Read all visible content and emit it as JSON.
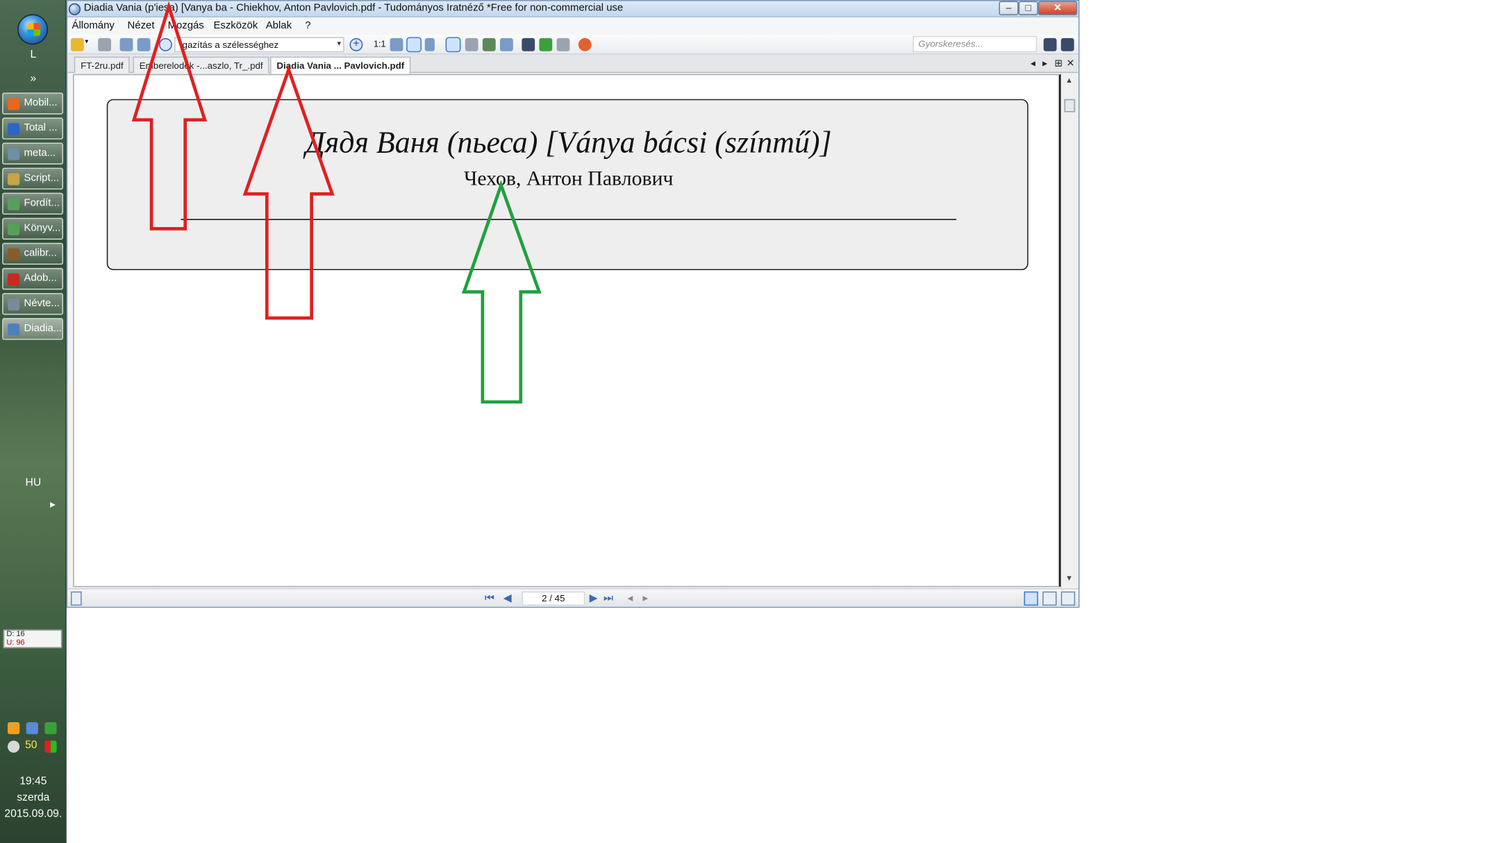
{
  "taskbar": {
    "letter": "L",
    "expand": "»",
    "buttons": [
      {
        "label": "Mobil...",
        "color": "#e8661e"
      },
      {
        "label": "Total ...",
        "color": "#2f65c8"
      },
      {
        "label": "meta...",
        "color": "#6f8fa8"
      },
      {
        "label": "Script...",
        "color": "#c9a347"
      },
      {
        "label": "Fordít...",
        "color": "#58a05a"
      },
      {
        "label": "Könyv...",
        "color": "#58a05a"
      },
      {
        "label": "calibr...",
        "color": "#8a5a2a"
      },
      {
        "label": "Adob...",
        "color": "#c92a1e"
      },
      {
        "label": "Névte...",
        "color": "#7a8a9a"
      },
      {
        "label": "Diadia...",
        "color": "#4f7fbf"
      }
    ],
    "net_down": "D: 16",
    "net_up": "U: 96",
    "lang": "HU",
    "tray_more": "▸",
    "tray_value": "50",
    "time": "19:45",
    "weekday": "szerda",
    "date": "2015.09.09."
  },
  "window": {
    "title": "Diadia Vania (p'iesa) [Vanya ba - Chiekhov, Anton Pavlovich.pdf - Tudományos Iratnéző *Free for non-commercial use",
    "minimize": "–",
    "maximize": "□",
    "close": "✕"
  },
  "menu": [
    "Állomány",
    "Nézet",
    "Mozgás",
    "Eszközök",
    "Ablak",
    "?"
  ],
  "toolbar": {
    "zoom_value": "Igazítás a szélességhez",
    "zoom_arrow": "▾",
    "zoom_plus": "+",
    "ratio": "1:1",
    "search_placeholder": "Gyorskeresés..."
  },
  "tabs": [
    {
      "label": "FT-2ru.pdf",
      "active": false
    },
    {
      "label": "Emberelodek -...aszlo, Tr_.pdf",
      "active": false
    },
    {
      "label": "Diadia Vania ... Pavlovich.pdf",
      "active": true
    }
  ],
  "tab_controls": {
    "prev": "◂",
    "next": "▸",
    "grid": "⊞",
    "close": "✕"
  },
  "document": {
    "title": "Дядя Ваня (пьеса) [Ványa bácsi (színmű)]",
    "author": "Чехов, Антон Павлович"
  },
  "scroll": {
    "up": "▲",
    "down": "▼"
  },
  "status": {
    "page": "2 / 45",
    "first": "⏮",
    "prev": "◀",
    "next": "▶",
    "last": "⏭",
    "back": "◂",
    "forward": "▸"
  },
  "annotations": {
    "arrow_red": "#e02020",
    "arrow_green": "#20a040"
  }
}
